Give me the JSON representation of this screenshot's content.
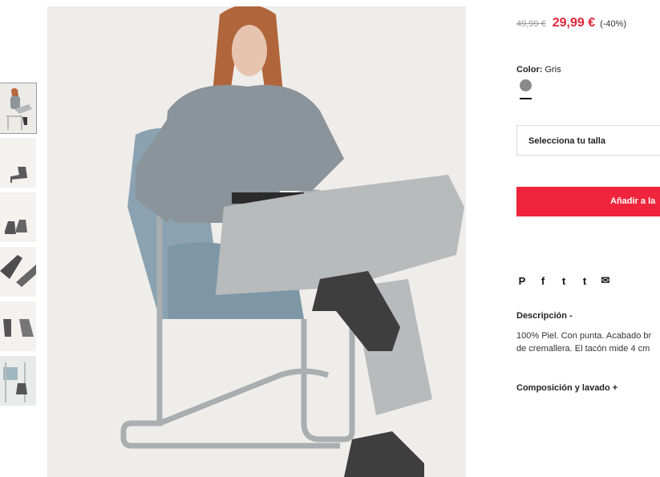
{
  "gallery": {
    "thumbnails": [
      {
        "name": "model-seated-view"
      },
      {
        "name": "boot-side-view"
      },
      {
        "name": "boots-pair-view"
      },
      {
        "name": "boot-detail-view"
      },
      {
        "name": "boot-heel-view"
      },
      {
        "name": "chair-boot-view"
      }
    ],
    "main_image": "model-seated-on-chrome-chair"
  },
  "price": {
    "old": "49,99 €",
    "new": "29,99 €",
    "discount": "(-40%)",
    "sale_color": "#e4253a"
  },
  "color": {
    "label": "Color:",
    "value": "Gris",
    "swatch": "#8a8a8a"
  },
  "size_select": {
    "label": "Selecciona tu talla"
  },
  "cart": {
    "button_label": "Añadir a la",
    "button_color": "#f0243c"
  },
  "share": {
    "pinterest": "P",
    "facebook": "f",
    "twitter": "t",
    "tumblr": "t",
    "email": "✉"
  },
  "description": {
    "title": "Descripción -",
    "line1": "100% Piel. Con punta. Acabado br",
    "line2": "de cremallera. El tacón mide 4 cm"
  },
  "composition": {
    "title": "Composición y lavado +"
  }
}
